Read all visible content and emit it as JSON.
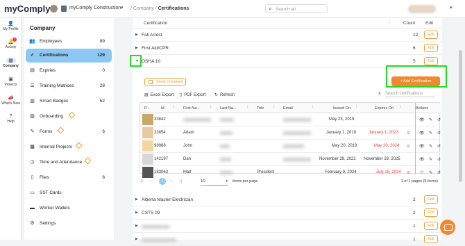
{
  "header": {
    "logo": "myComply",
    "org_name": "myComply Construction",
    "breadcrumb_parent": "Company",
    "breadcrumb_sep": "/",
    "breadcrumb_current": "Certifications",
    "search_placeholder": "Search all"
  },
  "rail": [
    {
      "label": "My Profile",
      "icon": "person-icon"
    },
    {
      "label": "Activity",
      "icon": "bell-icon",
      "badge": "1"
    },
    {
      "label": "Company",
      "icon": "building-icon",
      "active": true
    },
    {
      "label": "Projects",
      "icon": "projects-icon"
    },
    {
      "label": "What's New",
      "icon": "megaphone-icon"
    },
    {
      "label": "Help",
      "icon": "help-icon"
    }
  ],
  "sidebar": {
    "title": "Company",
    "items": [
      {
        "label": "Employees",
        "count": "89"
      },
      {
        "label": "Certifications",
        "count": "129",
        "active": true
      },
      {
        "label": "Expiries",
        "count": "0"
      },
      {
        "label": "Training Matrices",
        "count": "28"
      },
      {
        "label": "Smart Badges",
        "count": "52"
      },
      {
        "label": "Onboarding",
        "count": ""
      },
      {
        "label": "Forms",
        "count": "6"
      },
      {
        "label": "Internal Projects",
        "count": ""
      },
      {
        "label": "Time and Attendance",
        "count": ""
      },
      {
        "label": "Files",
        "count": "6"
      },
      {
        "label": "SST Cards",
        "count": ""
      },
      {
        "label": "Worker Wallets",
        "count": ""
      },
      {
        "label": "Settings",
        "count": ""
      }
    ]
  },
  "cert_table": {
    "col_certification": "Certification",
    "col_count": "Count",
    "col_edit": "Edit",
    "edit_label": "Edit",
    "rows_top": [
      {
        "name": "Fall Arrest",
        "count": "12"
      },
      {
        "name": "First Aid/CPR",
        "count": "6"
      },
      {
        "name": "OSHA 10",
        "count": "5"
      }
    ],
    "rows_bottom": [
      {
        "name": "Alberta Master Electrician",
        "count": "2"
      },
      {
        "name": "CSTS 09",
        "count": "2"
      },
      {
        "name": "",
        "count": "1"
      },
      {
        "name": "",
        "count": "1"
      }
    ]
  },
  "expanded": {
    "show_untrained": "Show Untrained",
    "add_certification": "Add Certification",
    "excel_export": "Excel Export",
    "pdf_export": "PDF Export",
    "refresh": "Refresh",
    "search_placeholder": "Search certifications",
    "columns": {
      "photo": "P...",
      "id": "Id",
      "first": "First Na...",
      "last": "Last Na...",
      "title": "Title",
      "email": "Email",
      "issued": "Issued On",
      "expires": "Expires On",
      "actions": "Actions"
    },
    "rows": [
      {
        "id": "33842",
        "first": "",
        "last": "",
        "title": "",
        "issued": "May 23, 2019",
        "expires": "",
        "expired": false
      },
      {
        "id": "33854",
        "first": "Adam",
        "last": "",
        "title": "",
        "issued": "January 1, 2018",
        "expires": "January 1, 2023",
        "expired": true
      },
      {
        "id": "98988",
        "first": "John",
        "last": "",
        "title": "",
        "issued": "May 20, 2019",
        "expires": "May 20, 2024",
        "expired": true
      },
      {
        "id": "142197",
        "first": "Dan",
        "last": "",
        "title": "",
        "issued": "November 29, 2022",
        "expires": "November 29, 2025",
        "expired": false
      },
      {
        "id": "183063",
        "first": "Matt",
        "last": "",
        "title": "President",
        "issued": "February 9, 2024",
        "expires": "July 15, 2024",
        "expired": true
      }
    ],
    "pager": {
      "current": "1",
      "page_size": "10",
      "items_per_page": "items per page",
      "info": "1 of 1 pages (5 items)"
    }
  },
  "colors": {
    "accent": "#f08a30",
    "active": "#8cc8f2",
    "highlight": "#22dd22",
    "expired": "#e53935"
  }
}
